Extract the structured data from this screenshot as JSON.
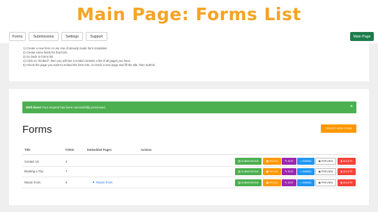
{
  "banner": {
    "title": "Main Page: Forms List"
  },
  "nav": {
    "items": [
      {
        "label": "Forms"
      },
      {
        "label": "Submissions"
      },
      {
        "label": "Settings"
      },
      {
        "label": "Support"
      }
    ],
    "main_page_label": "Main Page"
  },
  "instructions": {
    "lines": [
      "1) Create a new form or use one of already made form templates",
      "2) Create some fields for that form",
      "3) Go back to forms list",
      "4) Click on \"Embed\", then you will see a modal contains a list of all pages you have",
      "5) Check the page you want to embed the form into, or check a new page and fill the title, then Submit"
    ]
  },
  "alert": {
    "strong": "Well done!",
    "message": " Your request has been successfully processed.",
    "close": "×"
  },
  "page": {
    "title": "Forms",
    "create_label": "CREATE NEW FORM"
  },
  "table": {
    "headers": [
      "Title",
      "Fields",
      "Embedded Pages",
      "Actions"
    ],
    "rows": [
      {
        "title": "Contact Us",
        "fields": "4",
        "embedded": ""
      },
      {
        "title": "Booking a Trip",
        "fields": "7",
        "embedded": ""
      },
      {
        "title": "Return Form",
        "fields": "6",
        "embedded": "Return Form"
      }
    ],
    "actions": {
      "submissions": "SUBMISSIONS",
      "fields": "FIELDS",
      "edit": "EDIT",
      "embed": "EMBED",
      "preview": "PREVIEW",
      "delete": "DELETE"
    }
  },
  "icons": {
    "submissions": "list-icon",
    "fields": "grid-icon",
    "edit": "pencil-icon",
    "embed": "code-icon",
    "preview": "eye-icon",
    "delete": "trash-icon"
  },
  "colors": {
    "banner": "#f5a425",
    "main_page_button": "#1e7b4c",
    "alert": "#4caf50",
    "create_button": "#ff9800",
    "submissions": "#4caf50",
    "fields": "#ff9800",
    "edit": "#9c27b0",
    "embed": "#2196f3",
    "delete": "#f44336"
  }
}
